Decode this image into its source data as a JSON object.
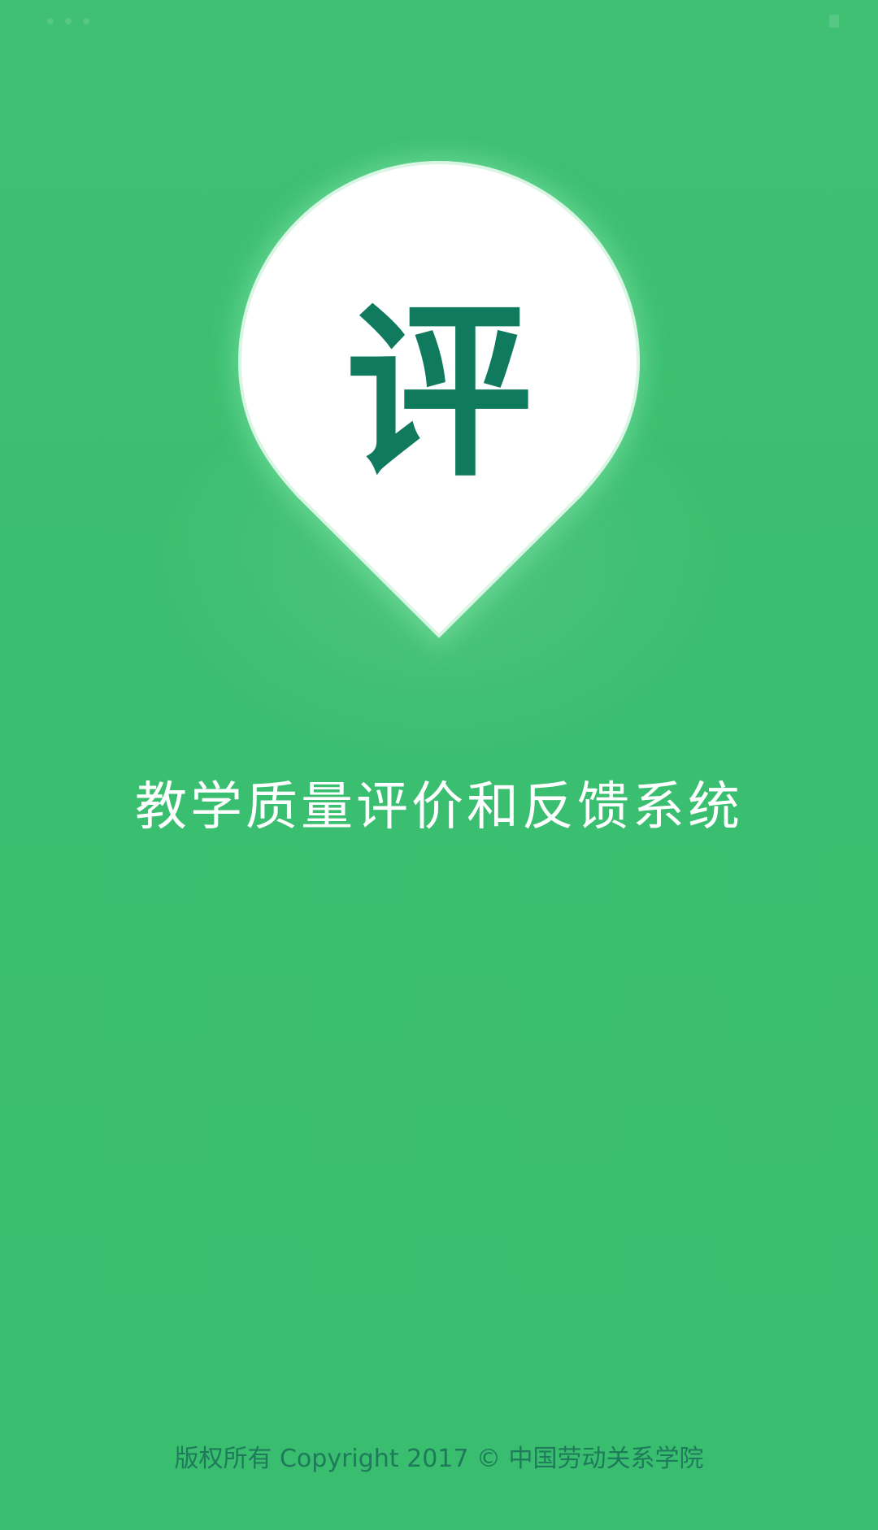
{
  "splash": {
    "logo_glyph": "评",
    "title": "教学质量评价和反馈系统",
    "copyright": "版权所有 Copyright 2017 © 中国劳动关系学院"
  },
  "colors": {
    "background": "#3bbd6e",
    "logo_pin": "#ffffff",
    "logo_glyph": "#0f7a5e",
    "title_text": "#ffffff",
    "copyright_text": "#1e7a5a"
  },
  "icons": {
    "logo": "map-pin-icon"
  }
}
